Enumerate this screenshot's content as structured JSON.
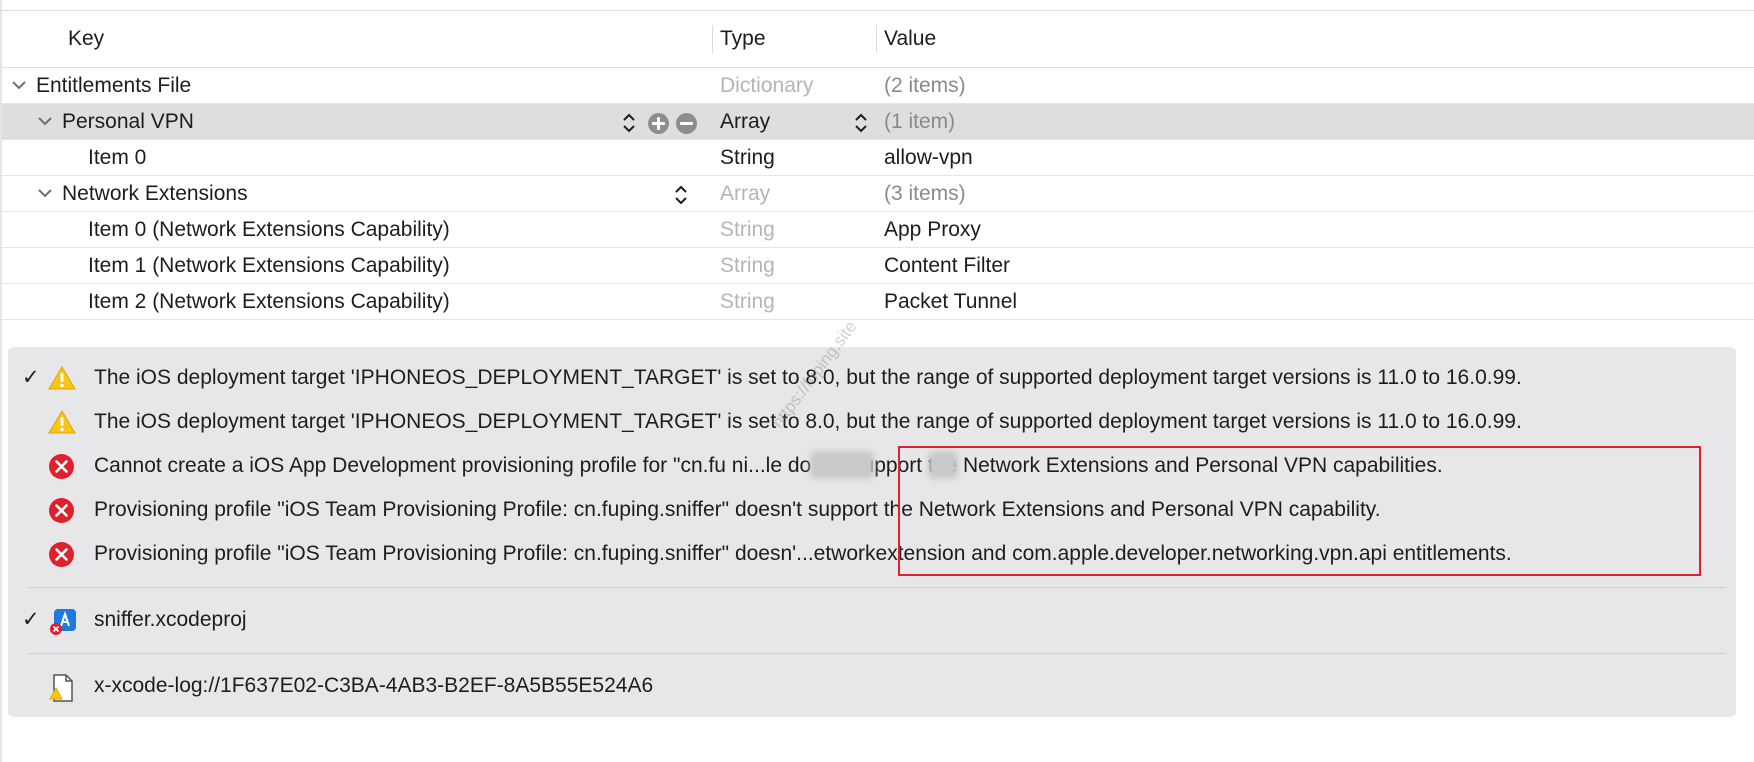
{
  "table": {
    "headers": {
      "key": "Key",
      "type": "Type",
      "value": "Value"
    },
    "rows": [
      {
        "key": "Entitlements File",
        "type": "Dictionary",
        "value": "(2 items)"
      },
      {
        "key": "Personal VPN",
        "type": "Array",
        "value": "(1 item)"
      },
      {
        "key": "Item 0",
        "type": "String",
        "value": "allow-vpn"
      },
      {
        "key": "Network Extensions",
        "type": "Array",
        "value": "(3 items)"
      },
      {
        "key": "Item 0 (Network Extensions Capability)",
        "type": "String",
        "value": "App Proxy"
      },
      {
        "key": "Item 1 (Network Extensions Capability)",
        "type": "String",
        "value": "Content Filter"
      },
      {
        "key": "Item 2 (Network Extensions Capability)",
        "type": "String",
        "value": "Packet Tunnel"
      }
    ]
  },
  "issues": {
    "items": [
      {
        "severity": "warning",
        "icon": "warning-icon",
        "text": "The iOS deployment target 'IPHONEOS_DEPLOYMENT_TARGET' is set to 8.0, but the range of supported deployment target versions is 11.0 to 16.0.99."
      },
      {
        "severity": "warning",
        "icon": "warning-icon",
        "text": "The iOS deployment target 'IPHONEOS_DEPLOYMENT_TARGET' is set to 8.0, but the range of supported deployment target versions is 11.0 to 16.0.99."
      },
      {
        "severity": "error",
        "icon": "error-icon",
        "text": "Cannot create a iOS App Development provisioning profile for \"cn.fu        ni...le      do not support the Network Extensions and Personal VPN capabilities."
      },
      {
        "severity": "error",
        "icon": "error-icon",
        "text": "Provisioning profile \"iOS Team Provisioning Profile: cn.fuping.sniffer\" doesn't support the Network Extensions and Personal VPN capability."
      },
      {
        "severity": "error",
        "icon": "error-icon",
        "text": "Provisioning profile \"iOS Team Provisioning Profile: cn.fuping.sniffer\" doesn'...etworkextension and com.apple.developer.networking.vpn.api entitlements."
      }
    ],
    "project": "sniffer.xcodeproj",
    "log_link": "x-xcode-log://1F637E02-C3BA-4AB3-B2EF-8A5B55E524A6",
    "check_mark": "✓"
  },
  "watermark": "https://fuping.site",
  "colors": {
    "warning": "#f5c518",
    "error": "#e0202a",
    "highlight": "#e0202a",
    "selected_row": "#dedede",
    "panel": "#e7e7e9"
  }
}
